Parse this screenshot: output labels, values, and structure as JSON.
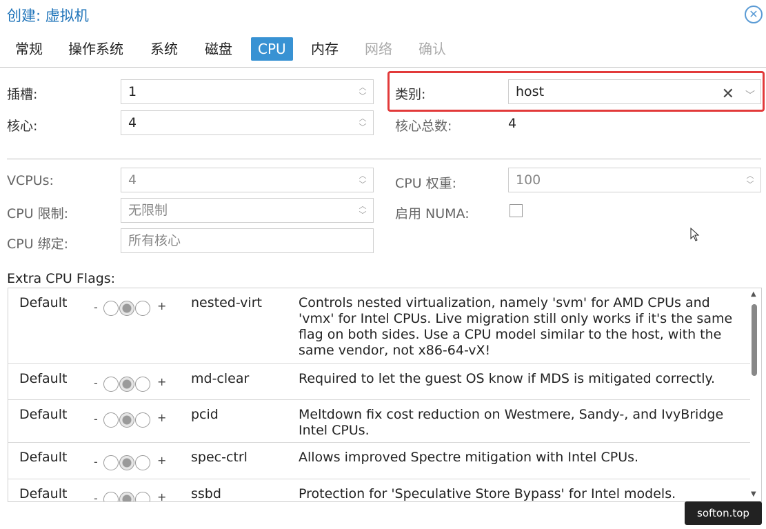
{
  "window": {
    "title": "创建: 虚拟机"
  },
  "tabs": [
    {
      "label": "常规",
      "state": "normal"
    },
    {
      "label": "操作系统",
      "state": "normal"
    },
    {
      "label": "系统",
      "state": "normal"
    },
    {
      "label": "磁盘",
      "state": "normal"
    },
    {
      "label": "CPU",
      "state": "active"
    },
    {
      "label": "内存",
      "state": "normal"
    },
    {
      "label": "网络",
      "state": "disabled"
    },
    {
      "label": "确认",
      "state": "disabled"
    }
  ],
  "form": {
    "sockets": {
      "label": "插槽:",
      "value": "1"
    },
    "cores": {
      "label": "核心:",
      "value": "4"
    },
    "type": {
      "label": "类别:",
      "value": "host"
    },
    "total_cores": {
      "label": "核心总数:",
      "value": "4"
    },
    "vcpus": {
      "label": "VCPUs:",
      "value": "4"
    },
    "cpu_weight": {
      "label": "CPU 权重:",
      "value": "100"
    },
    "cpu_limit": {
      "label": "CPU 限制:",
      "value": "无限制"
    },
    "numa": {
      "label": "启用 NUMA:",
      "checked": false
    },
    "cpu_affinity": {
      "label": "CPU 绑定:",
      "placeholder": "所有核心"
    }
  },
  "flags": {
    "label": "Extra CPU Flags:",
    "rows": [
      {
        "state": "Default",
        "minus": "-",
        "plus": "+",
        "name": "nested-virt",
        "description": "Controls nested virtualization, namely 'svm' for AMD CPUs and 'vmx' for Intel CPUs. Live migration still only works if it's the same flag on both sides. Use a CPU model similar to the host, with the same vendor, not x86-64-vX!"
      },
      {
        "state": "Default",
        "minus": "-",
        "plus": "+",
        "name": "md-clear",
        "description": "Required to let the guest OS know if MDS is mitigated correctly."
      },
      {
        "state": "Default",
        "minus": "-",
        "plus": "+",
        "name": "pcid",
        "description": "Meltdown fix cost reduction on Westmere, Sandy-, and IvyBridge Intel CPUs."
      },
      {
        "state": "Default",
        "minus": "-",
        "plus": "+",
        "name": "spec-ctrl",
        "description": "Allows improved Spectre mitigation with Intel CPUs."
      },
      {
        "state": "Default",
        "minus": "-",
        "plus": "+",
        "name": "ssbd",
        "description": "Protection for 'Speculative Store Bypass' for Intel models."
      }
    ]
  },
  "watermark": "softon.top",
  "icons": {
    "close": "close-circle-icon",
    "clear": "clear-x-icon",
    "dropdown": "chevron-down-icon",
    "spinner": "spinner-arrows-icon"
  },
  "colors": {
    "accent": "#3892d3",
    "title": "#1e73b9",
    "highlight": "#e23a3a"
  }
}
